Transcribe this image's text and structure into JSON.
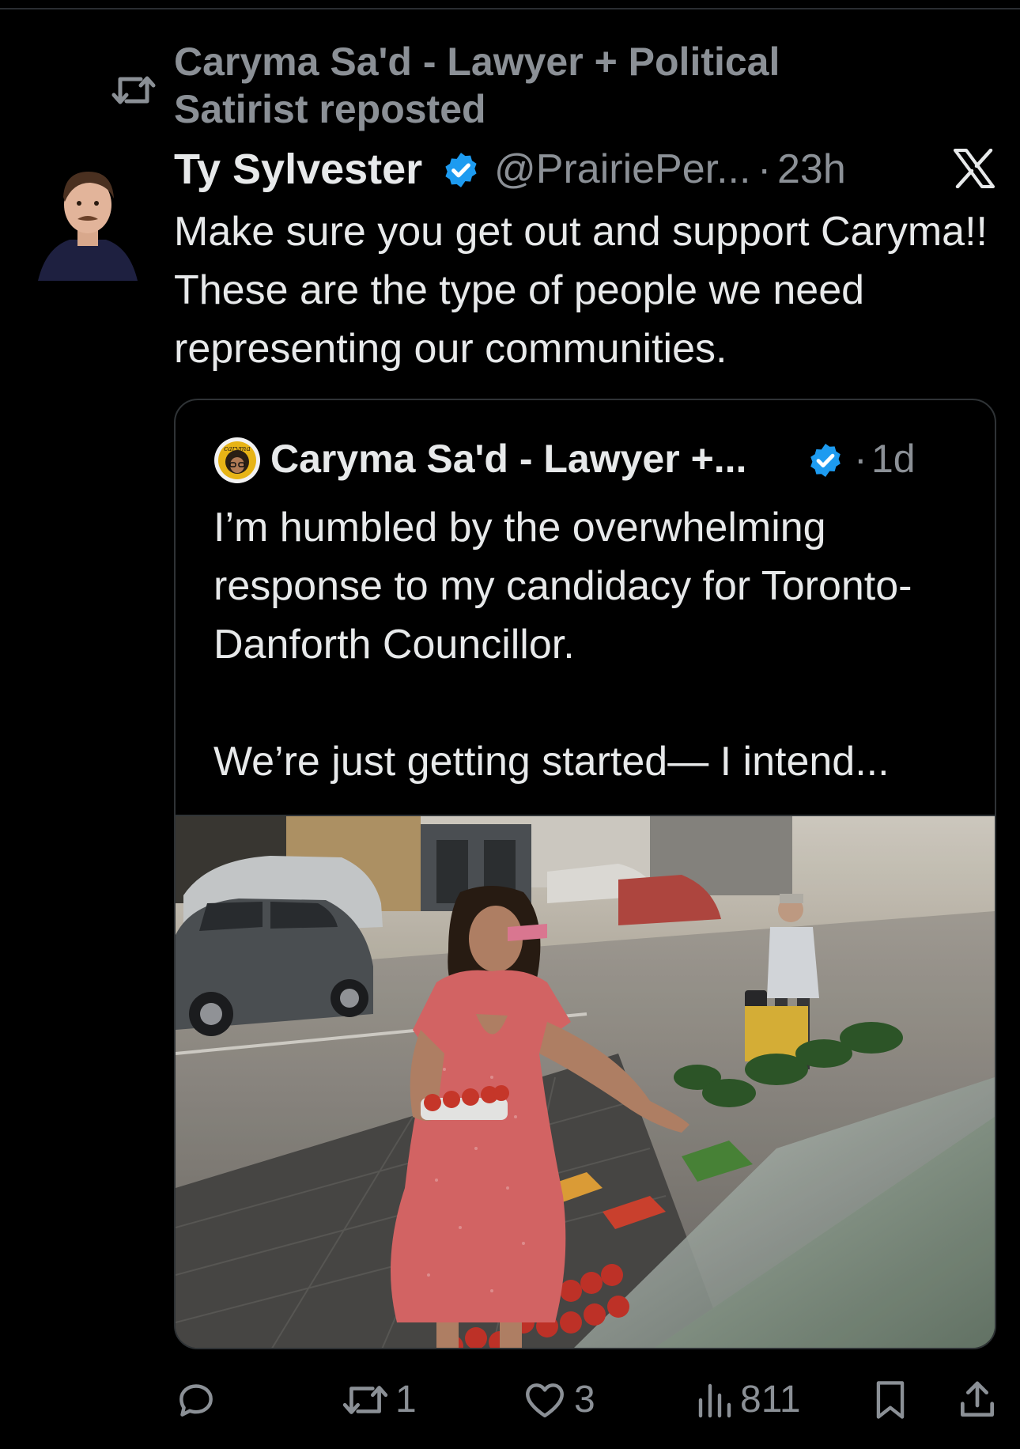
{
  "repost": {
    "text": "Caryma Sa'd - Lawyer + Political Satirist reposted"
  },
  "tweet": {
    "author_name": "Ty Sylvester",
    "handle": "@PrairiePer...",
    "separator": "·",
    "time": "23h",
    "text": "Make sure you get out and support Caryma!! These are the type of people we need representing our communities."
  },
  "quote": {
    "author_name": "Caryma Sa'd - Lawyer +...",
    "separator": "·",
    "time": "1d",
    "paragraph_1": "I’m humbled by the overwhelming response to my candidacy for Toronto-Danforth Councillor.",
    "paragraph_2": "We’re just getting started— I intend...",
    "avatar_logo_text": "caryma"
  },
  "actions": {
    "reply_count": "",
    "repost_count": "1",
    "like_count": "3",
    "views_count": "811"
  },
  "colors": {
    "background": "#000000",
    "primary_text": "#e7e9ea",
    "secondary_text": "#8b9096",
    "verified_blue": "#1d9bf0",
    "border": "#2f3336"
  },
  "icons": {
    "repost": "repost-icon",
    "verified": "verified-badge-icon",
    "brand": "x-logo-icon",
    "reply": "reply-icon",
    "like": "heart-icon",
    "views": "views-icon",
    "bookmark": "bookmark-icon",
    "share": "share-icon"
  }
}
